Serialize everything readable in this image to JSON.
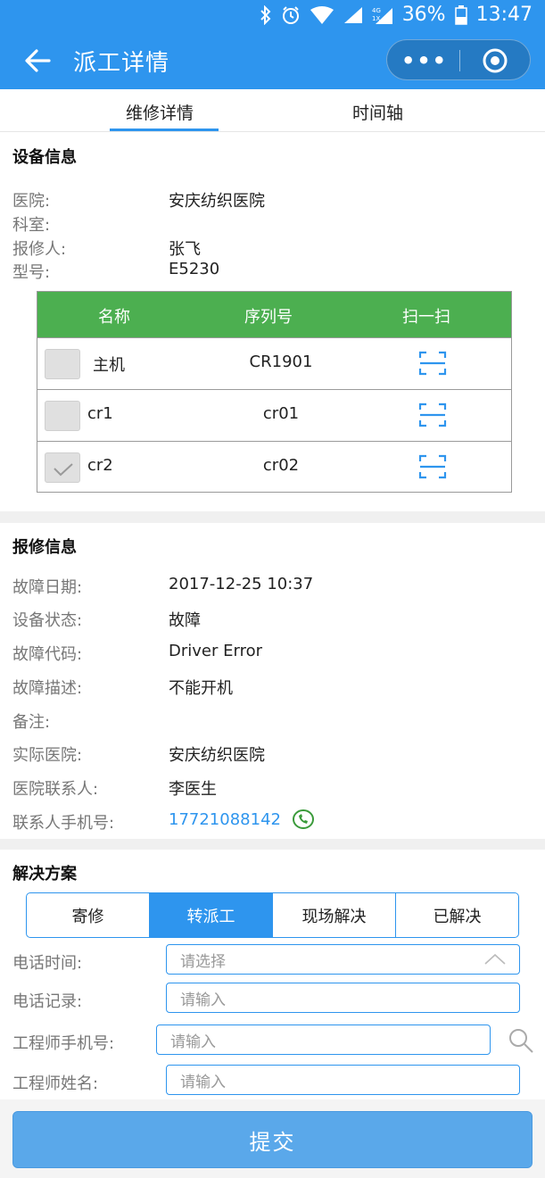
{
  "status_bar": {
    "battery": "36%",
    "time": "13:47"
  },
  "header": {
    "title": "派工详情",
    "capsule_more": "•••"
  },
  "tabs": [
    {
      "label": "维修详情",
      "active": true
    },
    {
      "label": "时间轴",
      "active": false
    }
  ],
  "device_info": {
    "title": "设备信息",
    "fields": [
      {
        "label": "医院:",
        "value": "安庆纺织医院"
      },
      {
        "label": "科室:",
        "value": ""
      },
      {
        "label": "报修人:",
        "value": "张飞"
      },
      {
        "label": "型号:",
        "value": "E5230"
      }
    ],
    "table": {
      "headers": [
        "名称",
        "序列号",
        "扫一扫"
      ],
      "rows": [
        {
          "name": "主机",
          "serial": "CR1901",
          "checked": false
        },
        {
          "name": "cr1",
          "serial": "cr01",
          "checked": false
        },
        {
          "name": "cr2",
          "serial": "cr02",
          "checked": true
        }
      ]
    }
  },
  "repair_info": {
    "title": "报修信息",
    "fields": [
      {
        "label": "故障日期:",
        "value": "2017-12-25 10:37"
      },
      {
        "label": "设备状态:",
        "value": "故障"
      },
      {
        "label": "故障代码:",
        "value": "Driver Error"
      },
      {
        "label": "故障描述:",
        "value": "不能开机"
      },
      {
        "label": "备注:",
        "value": ""
      },
      {
        "label": "实际医院:",
        "value": "安庆纺织医院"
      },
      {
        "label": "医院联系人:",
        "value": "李医生"
      },
      {
        "label": "联系人手机号:",
        "value": "17721088142"
      }
    ]
  },
  "solution": {
    "title": "解决方案",
    "options": [
      "寄修",
      "转派工",
      "现场解决",
      "已解决"
    ],
    "selected": "转派工",
    "form": [
      {
        "label": "电话时间:",
        "placeholder": "请选择"
      },
      {
        "label": "电话记录:",
        "placeholder": "请输入"
      },
      {
        "label": "工程师手机号:",
        "placeholder": "请输入"
      },
      {
        "label": "工程师姓名:",
        "placeholder": "请输入"
      }
    ]
  },
  "submit_label": "提交",
  "colors": {
    "primary": "#2e95ee",
    "table_header": "#4caf50",
    "submit": "#5aa8ea",
    "phone_link": "#2e95ee"
  }
}
